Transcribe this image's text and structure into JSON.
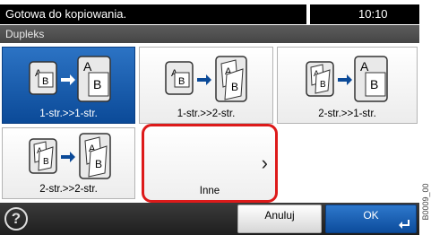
{
  "status": {
    "text": "Gotowa do kopiowania.",
    "time": "10:10"
  },
  "subtitle": "Dupleks",
  "options": [
    {
      "label": "1-str.>>1-str.",
      "selected": true
    },
    {
      "label": "1-str.>>2-str."
    },
    {
      "label": "2-str.>>1-str."
    },
    {
      "label": "2-str.>>2-str."
    },
    {
      "label": "Inne",
      "highlighted": true
    }
  ],
  "buttons": {
    "cancel": "Anuluj",
    "ok": "OK"
  },
  "side_code": "B0009_00",
  "colors": {
    "accent": "#0b4a98",
    "highlight": "#dd1a1a"
  }
}
